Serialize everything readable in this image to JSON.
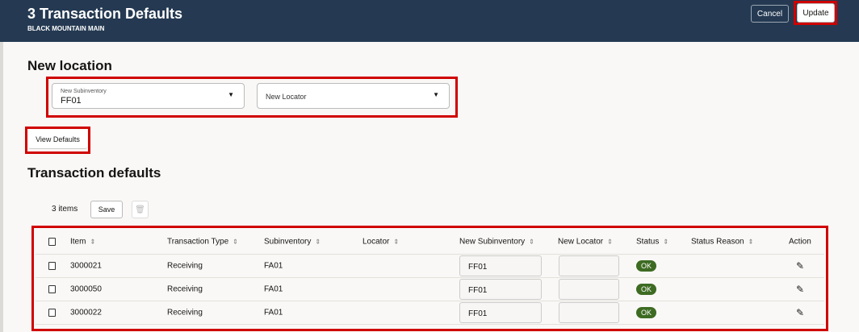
{
  "header": {
    "title": "3 Transaction Defaults",
    "subtitle": "BLACK MOUNTAIN MAIN",
    "cancel_label": "Cancel",
    "update_label": "Update"
  },
  "new_location": {
    "heading": "New location",
    "subinventory_label": "New Subinventory",
    "subinventory_value": "FF01",
    "locator_placeholder": "New Locator",
    "view_defaults_label": "View Defaults"
  },
  "defaults": {
    "heading": "Transaction defaults",
    "count": "3 items",
    "save_label": "Save",
    "columns": [
      "Item",
      "Transaction Type",
      "Subinventory",
      "Locator",
      "New Subinventory",
      "New Locator",
      "Status",
      "Status Reason",
      "Action"
    ],
    "rows": [
      {
        "item": "3000021",
        "type": "Receiving",
        "sub": "FA01",
        "locator": "",
        "new_sub": "FF01",
        "new_loc": "",
        "status": "OK",
        "reason": ""
      },
      {
        "item": "3000050",
        "type": "Receiving",
        "sub": "FA01",
        "locator": "",
        "new_sub": "FF01",
        "new_loc": "",
        "status": "OK",
        "reason": ""
      },
      {
        "item": "3000022",
        "type": "Receiving",
        "sub": "FA01",
        "locator": "",
        "new_sub": "FF01",
        "new_loc": "",
        "status": "OK",
        "reason": ""
      }
    ]
  },
  "colors": {
    "header_bg": "#253a52",
    "highlight": "#d00000",
    "status_ok": "#3d6b22"
  }
}
